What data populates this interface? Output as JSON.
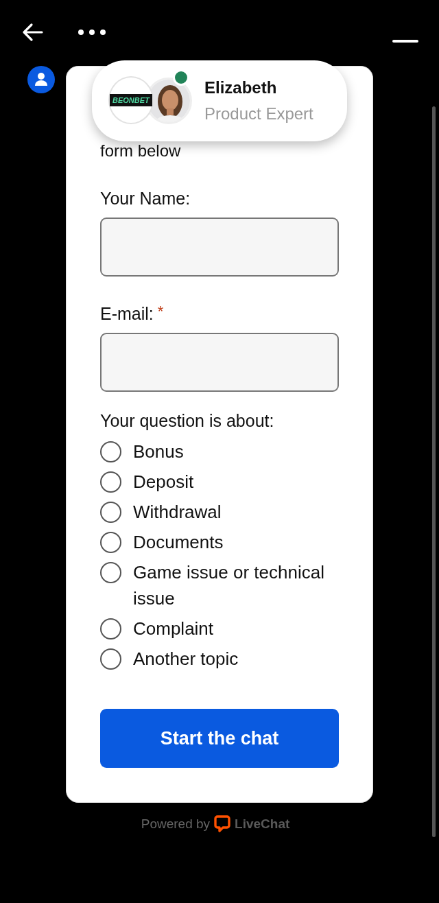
{
  "agent": {
    "brand": "BEONBET",
    "name": "Elizabeth",
    "role": "Product Expert",
    "online": true
  },
  "intro": "form below",
  "fields": [
    {
      "label": "Your Name:"
    },
    {
      "label": "E-mail:",
      "required_mark": "*"
    }
  ],
  "question": {
    "label": "Your question is about:",
    "options": [
      {
        "label": "Bonus",
        "selected": false
      },
      {
        "label": "Deposit",
        "selected": false
      },
      {
        "label": "Withdrawal",
        "selected": false
      },
      {
        "label": "Documents",
        "selected": false
      },
      {
        "label": "Game issue or technical issue",
        "selected": false
      },
      {
        "label": "Complaint",
        "selected": false
      },
      {
        "label": "Another topic",
        "selected": false
      }
    ]
  },
  "submit": "Start the chat",
  "footer": {
    "prefix": "Powered by",
    "brand": "LiveChat"
  }
}
